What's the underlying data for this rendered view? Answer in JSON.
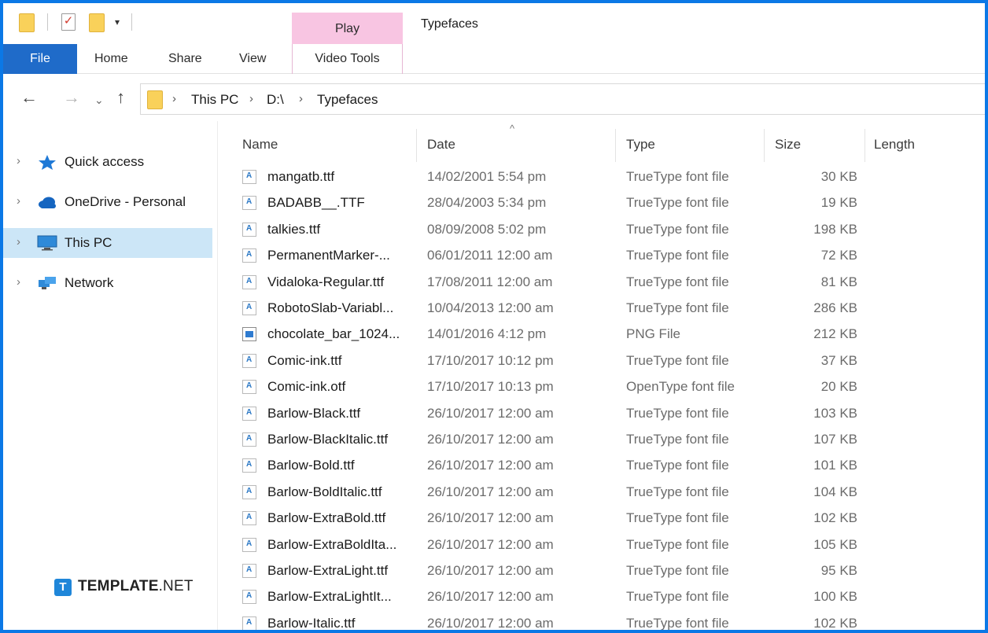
{
  "window": {
    "title": "Typefaces"
  },
  "ribbon": {
    "context_header": "Play",
    "tabs": [
      "File",
      "Home",
      "Share",
      "View",
      "Video Tools"
    ]
  },
  "address": {
    "crumbs": [
      "This PC",
      "D:\\",
      "Typefaces"
    ]
  },
  "nav_pane": {
    "items": [
      {
        "label": "Quick access",
        "icon": "star-icon",
        "selected": false
      },
      {
        "label": "OneDrive - Personal",
        "icon": "cloud-icon",
        "selected": false
      },
      {
        "label": "This PC",
        "icon": "monitor-icon",
        "selected": true
      },
      {
        "label": "Network",
        "icon": "network-icon",
        "selected": false
      }
    ]
  },
  "columns": [
    "Name",
    "Date",
    "Type",
    "Size",
    "Length"
  ],
  "files": [
    {
      "name": "mangatb.ttf",
      "date": "14/02/2001 5:54 pm",
      "type": "TrueType font file",
      "size": "30 KB",
      "icon": "font-file-icon"
    },
    {
      "name": "BADABB__.TTF",
      "date": "28/04/2003 5:34 pm",
      "type": "TrueType font file",
      "size": "19 KB",
      "icon": "font-file-icon"
    },
    {
      "name": "talkies.ttf",
      "date": "08/09/2008 5:02 pm",
      "type": "TrueType font file",
      "size": "198 KB",
      "icon": "font-file-icon"
    },
    {
      "name": "PermanentMarker-...",
      "date": "06/01/2011 12:00 am",
      "type": "TrueType font file",
      "size": "72 KB",
      "icon": "font-file-icon"
    },
    {
      "name": "Vidaloka-Regular.ttf",
      "date": "17/08/2011 12:00 am",
      "type": "TrueType font file",
      "size": "81 KB",
      "icon": "font-file-icon"
    },
    {
      "name": "RobotoSlab-Variabl...",
      "date": "10/04/2013 12:00 am",
      "type": "TrueType font file",
      "size": "286 KB",
      "icon": "font-file-icon"
    },
    {
      "name": "chocolate_bar_1024...",
      "date": "14/01/2016 4:12 pm",
      "type": "PNG File",
      "size": "212 KB",
      "icon": "image-file-icon"
    },
    {
      "name": "Comic-ink.ttf",
      "date": "17/10/2017 10:12 pm",
      "type": "TrueType font file",
      "size": "37 KB",
      "icon": "font-file-icon"
    },
    {
      "name": "Comic-ink.otf",
      "date": "17/10/2017 10:13 pm",
      "type": "OpenType font file",
      "size": "20 KB",
      "icon": "font-file-icon"
    },
    {
      "name": "Barlow-Black.ttf",
      "date": "26/10/2017 12:00 am",
      "type": "TrueType font file",
      "size": "103 KB",
      "icon": "font-file-icon"
    },
    {
      "name": "Barlow-BlackItalic.ttf",
      "date": "26/10/2017 12:00 am",
      "type": "TrueType font file",
      "size": "107 KB",
      "icon": "font-file-icon"
    },
    {
      "name": "Barlow-Bold.ttf",
      "date": "26/10/2017 12:00 am",
      "type": "TrueType font file",
      "size": "101 KB",
      "icon": "font-file-icon"
    },
    {
      "name": "Barlow-BoldItalic.ttf",
      "date": "26/10/2017 12:00 am",
      "type": "TrueType font file",
      "size": "104 KB",
      "icon": "font-file-icon"
    },
    {
      "name": "Barlow-ExtraBold.ttf",
      "date": "26/10/2017 12:00 am",
      "type": "TrueType font file",
      "size": "102 KB",
      "icon": "font-file-icon"
    },
    {
      "name": "Barlow-ExtraBoldIta...",
      "date": "26/10/2017 12:00 am",
      "type": "TrueType font file",
      "size": "105 KB",
      "icon": "font-file-icon"
    },
    {
      "name": "Barlow-ExtraLight.ttf",
      "date": "26/10/2017 12:00 am",
      "type": "TrueType font file",
      "size": "95 KB",
      "icon": "font-file-icon"
    },
    {
      "name": "Barlow-ExtraLightIt...",
      "date": "26/10/2017 12:00 am",
      "type": "TrueType font file",
      "size": "100 KB",
      "icon": "font-file-icon"
    },
    {
      "name": "Barlow-Italic.ttf",
      "date": "26/10/2017 12:00 am",
      "type": "TrueType font file",
      "size": "102 KB",
      "icon": "font-file-icon"
    }
  ],
  "watermark": {
    "brand": "TEMPLATE",
    "suffix": ".NET",
    "logo_letter": "T"
  },
  "colors": {
    "frame_border": "#0b78e6",
    "file_tab": "#1f6bc9",
    "play_context": "#f8c5e2",
    "selected_nav": "#cce6f7"
  }
}
